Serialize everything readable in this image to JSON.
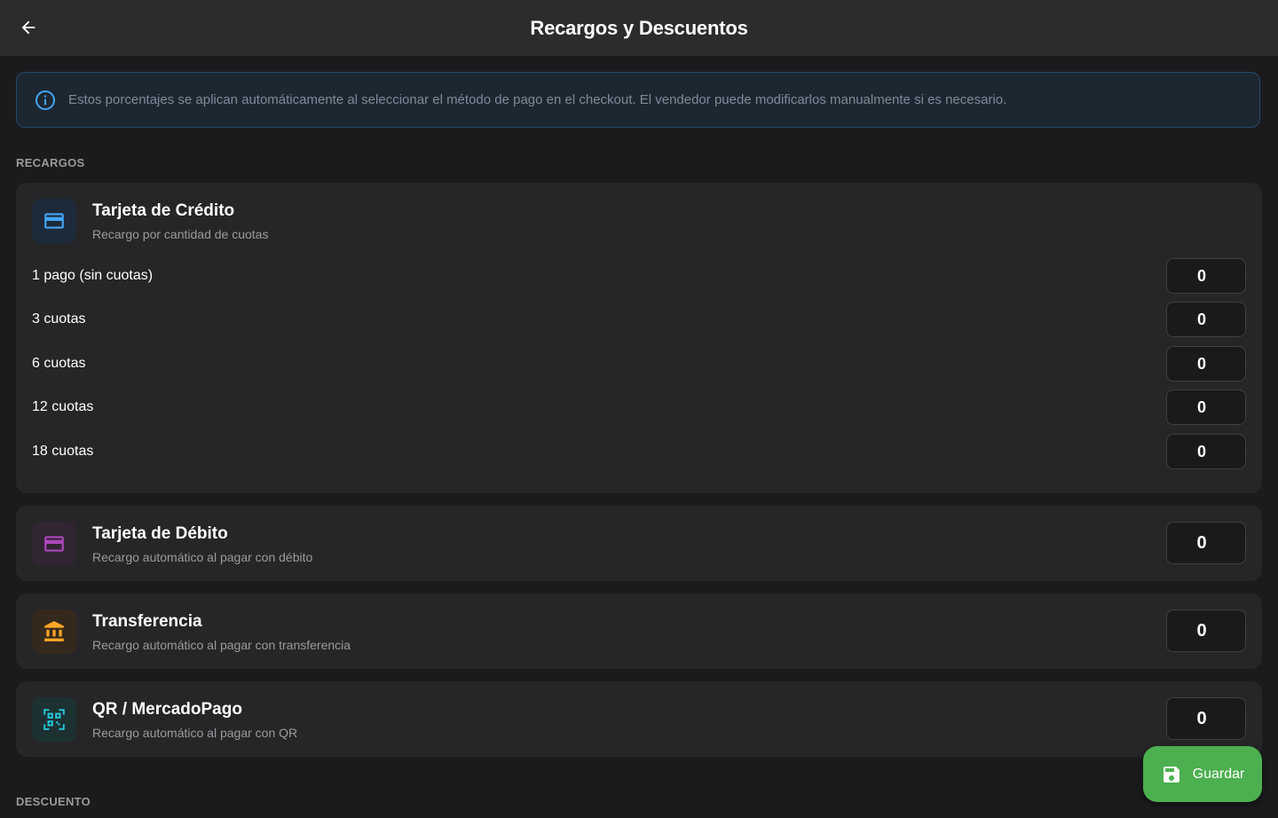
{
  "header": {
    "title": "Recargos y Descuentos",
    "back_icon": "arrow-left-icon"
  },
  "info_banner": {
    "icon": "info-icon",
    "text": "Estos porcentajes se aplican automáticamente al seleccionar el método de pago en el checkout. El vendedor puede modificarlos manualmente si es necesario."
  },
  "sections": {
    "recargos_label": "RECARGOS",
    "descuento_label": "DESCUENTO"
  },
  "credit": {
    "icon": "credit-card-icon",
    "title": "Tarjeta de Crédito",
    "subtitle": "Recargo por cantidad de cuotas",
    "rows": [
      {
        "label": "1 pago (sin cuotas)",
        "value": "0"
      },
      {
        "label": "3 cuotas",
        "value": "0"
      },
      {
        "label": "6 cuotas",
        "value": "0"
      },
      {
        "label": "12 cuotas",
        "value": "0"
      },
      {
        "label": "18 cuotas",
        "value": "0"
      }
    ]
  },
  "debit": {
    "icon": "debit-card-icon",
    "title": "Tarjeta de Débito",
    "subtitle": "Recargo automático al pagar con débito",
    "value": "0"
  },
  "transfer": {
    "icon": "bank-icon",
    "title": "Transferencia",
    "subtitle": "Recargo automático al pagar con transferencia",
    "value": "0"
  },
  "qr": {
    "icon": "qr-code-icon",
    "title": "QR / MercadoPago",
    "subtitle": "Recargo automático al pagar con QR",
    "value": "0"
  },
  "save_button": {
    "icon": "save-icon",
    "label": "Guardar"
  },
  "colors": {
    "credit_accent": "#42a5f5",
    "debit_accent": "#ab47bc",
    "transfer_accent": "#ffa726",
    "qr_accent": "#26c6da",
    "save_green": "#4caf50"
  }
}
